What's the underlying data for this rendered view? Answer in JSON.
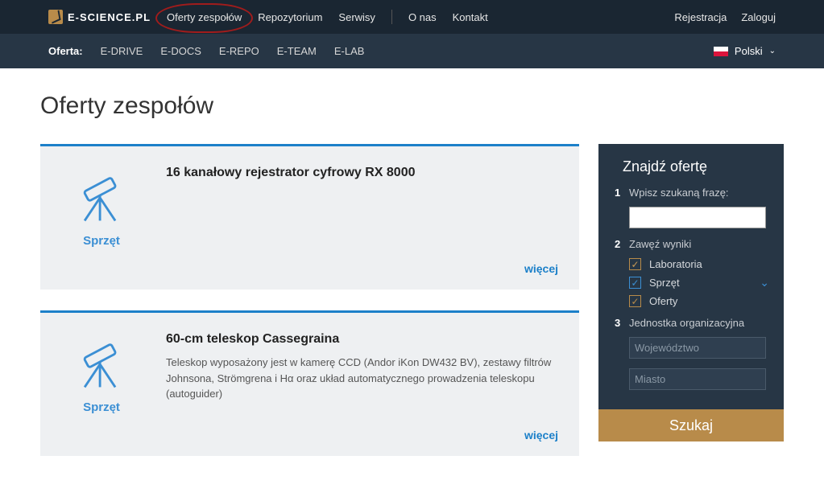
{
  "brand": {
    "name": "E-SCIENCE.PL"
  },
  "topnav": {
    "oferty": "Oferty zespołów",
    "repo": "Repozytorium",
    "serwisy": "Serwisy",
    "onas": "O nas",
    "kontakt": "Kontakt",
    "rejestracja": "Rejestracja",
    "zaloguj": "Zaloguj"
  },
  "subnav": {
    "label": "Oferta:",
    "items": [
      "E-DRIVE",
      "E-DOCS",
      "E-REPO",
      "E-TEAM",
      "E-LAB"
    ],
    "lang": "Polski"
  },
  "page": {
    "title": "Oferty zespołów"
  },
  "cards": [
    {
      "category": "Sprzęt",
      "title": "16 kanałowy rejestrator cyfrowy RX 8000",
      "desc": "",
      "more": "więcej"
    },
    {
      "category": "Sprzęt",
      "title": "60-cm teleskop Cassegraina",
      "desc": "Teleskop wyposażony jest w kamerę CCD (Andor iKon DW432 BV), zestawy filtrów Johnsona, Strömgrena i Hα oraz układ automatycznego prowadzenia teleskopu (autoguider)",
      "more": "więcej"
    }
  ],
  "sidebar": {
    "title": "Znajdź ofertę",
    "step1": "Wpisz szukaną frazę:",
    "step2": "Zawęź wyniki",
    "step3": "Jednostka organizacyjna",
    "filters": {
      "lab": "Laboratoria",
      "sprzet": "Sprzęt",
      "oferty": "Oferty"
    },
    "placeholders": {
      "woj": "Województwo",
      "miasto": "Miasto"
    },
    "search": "Szukaj"
  }
}
